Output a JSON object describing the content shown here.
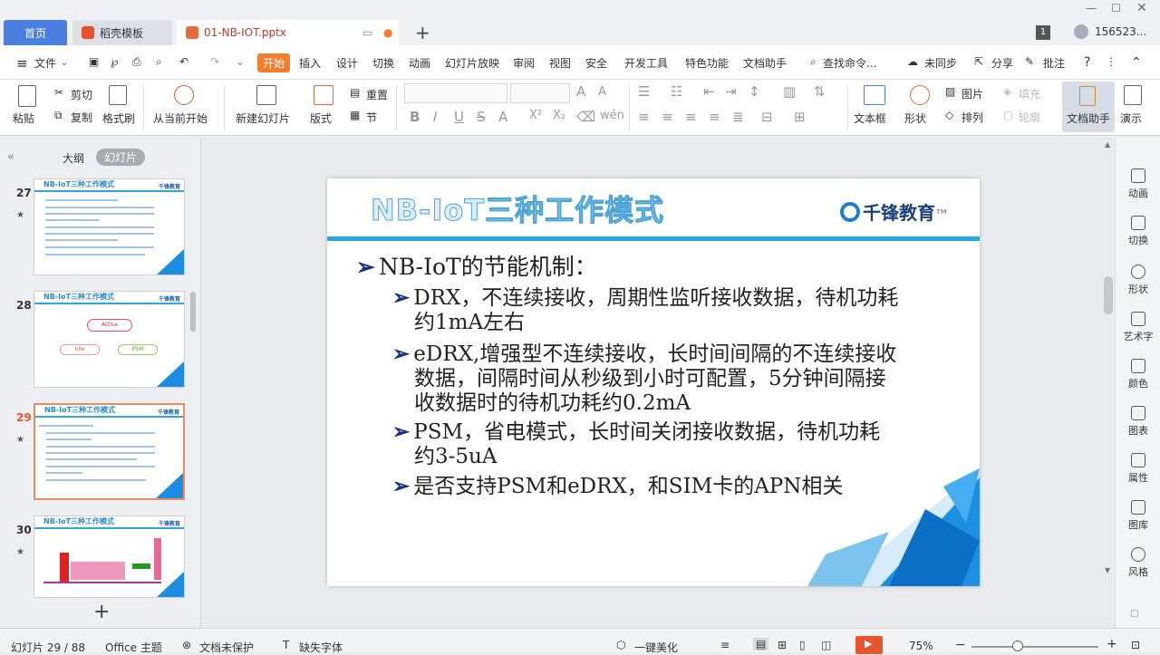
{
  "tabs": {
    "home": "首页",
    "daoke": "稻壳模板",
    "file": "01-NB-IOT.pptx",
    "badge": "1",
    "user": "156523..."
  },
  "menu": [
    "文件",
    "开始",
    "插入",
    "设计",
    "切换",
    "动画",
    "幻灯片放映",
    "审阅",
    "视图",
    "安全",
    "开发工具",
    "特色功能",
    "文档助手",
    "查找命令...",
    "未同步",
    "分享",
    "批注"
  ],
  "ribbon": {
    "paste": "粘贴",
    "cut": "剪切",
    "copy": "复制",
    "format_painter": "格式刷",
    "from_start": "从当前开始",
    "new_slide": "新建幻灯片",
    "layout": "版式",
    "reset": "重置",
    "section": "节",
    "textbox": "文本框",
    "shape": "形状",
    "picture": "图片",
    "fill": "填充",
    "arrange": "排列",
    "outline": "轮廓",
    "doc_helper": "文档助手",
    "present": "演示"
  },
  "leftpanel": {
    "outline_tab": "大纲",
    "slides_tab": "幻灯片",
    "add": "+",
    "thumbs": [
      {
        "num": "27",
        "title": "NB-IoT三种工作模式",
        "logo": "千锋教育"
      },
      {
        "num": "28",
        "title": "NB-IoT三种工作模式",
        "logo": "千锋教育",
        "labels": [
          "Active",
          "Idle",
          "PSM"
        ]
      },
      {
        "num": "29",
        "title": "NB-IoT三种工作模式",
        "logo": "千锋教育"
      },
      {
        "num": "30",
        "title": "NB-IoT三种工作模式",
        "logo": "千锋教育"
      }
    ]
  },
  "slide": {
    "title": "NB-IoT三种工作模式",
    "logo_text": "千锋教育",
    "logo_tm": "TM",
    "bullet_main": "NB-IoT的节能机制：",
    "bullets": [
      "DRX，不连续接收，周期性监听接收数据，待机功耗约1mA左右",
      "eDRX,增强型不连续接收，长时间间隔的不连续接收数据，间隔时间从秒级到小时可配置，5分钟间隔接收数据时的待机功耗约0.2mA",
      "PSM，省电模式，长时间关闭接收数据，待机功耗约3-5uA",
      "是否支持PSM和eDRX，和SIM卡的APN相关"
    ]
  },
  "rightpanel": [
    "动画",
    "切换",
    "形状",
    "艺术字",
    "颜色",
    "图表",
    "属性",
    "图库",
    "风格"
  ],
  "status": {
    "slide": "幻灯片 29 / 88",
    "theme": "Office 主题",
    "protect": "文档未保护",
    "font": "缺失字体",
    "beautify": "一键美化",
    "zoom": "75%"
  },
  "colors": {
    "accent": "#f57c2d",
    "tab_blue": "#4a7fe0",
    "slide_bar": "#28a7e1"
  }
}
